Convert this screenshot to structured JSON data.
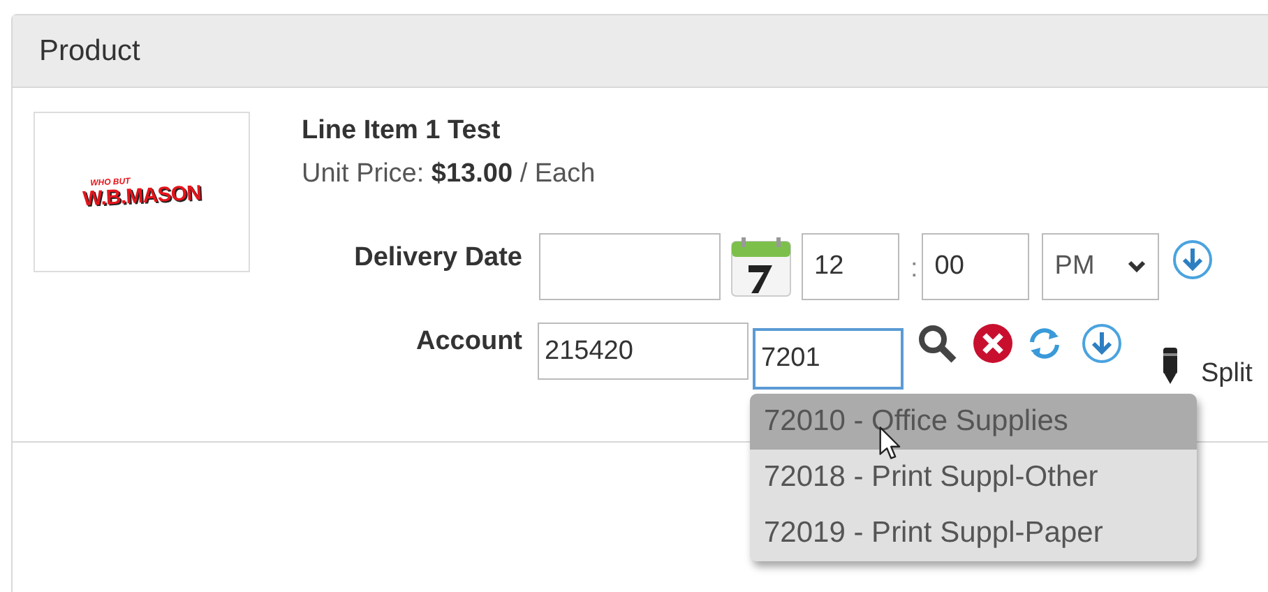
{
  "panel": {
    "title": "Product"
  },
  "product": {
    "logo_text": "W.B.MASON",
    "logo_tagline": "WHO BUT",
    "name": "Line Item 1 Test",
    "price_label": "Unit Price:",
    "price": "$13.00",
    "unit": "/ Each"
  },
  "delivery": {
    "label": "Delivery Date",
    "hour": "12",
    "separator": ":",
    "minute": "00",
    "ampm": "PM"
  },
  "account": {
    "label": "Account",
    "code": "215420",
    "sub_code": "7201",
    "focused": true,
    "split_label": "Split"
  },
  "suggestions": [
    {
      "label": "72010 - Office Supplies",
      "selected": true
    },
    {
      "label": "72018 - Print Suppl-Other",
      "selected": false
    },
    {
      "label": "72019 - Print Suppl-Paper",
      "selected": false
    }
  ]
}
